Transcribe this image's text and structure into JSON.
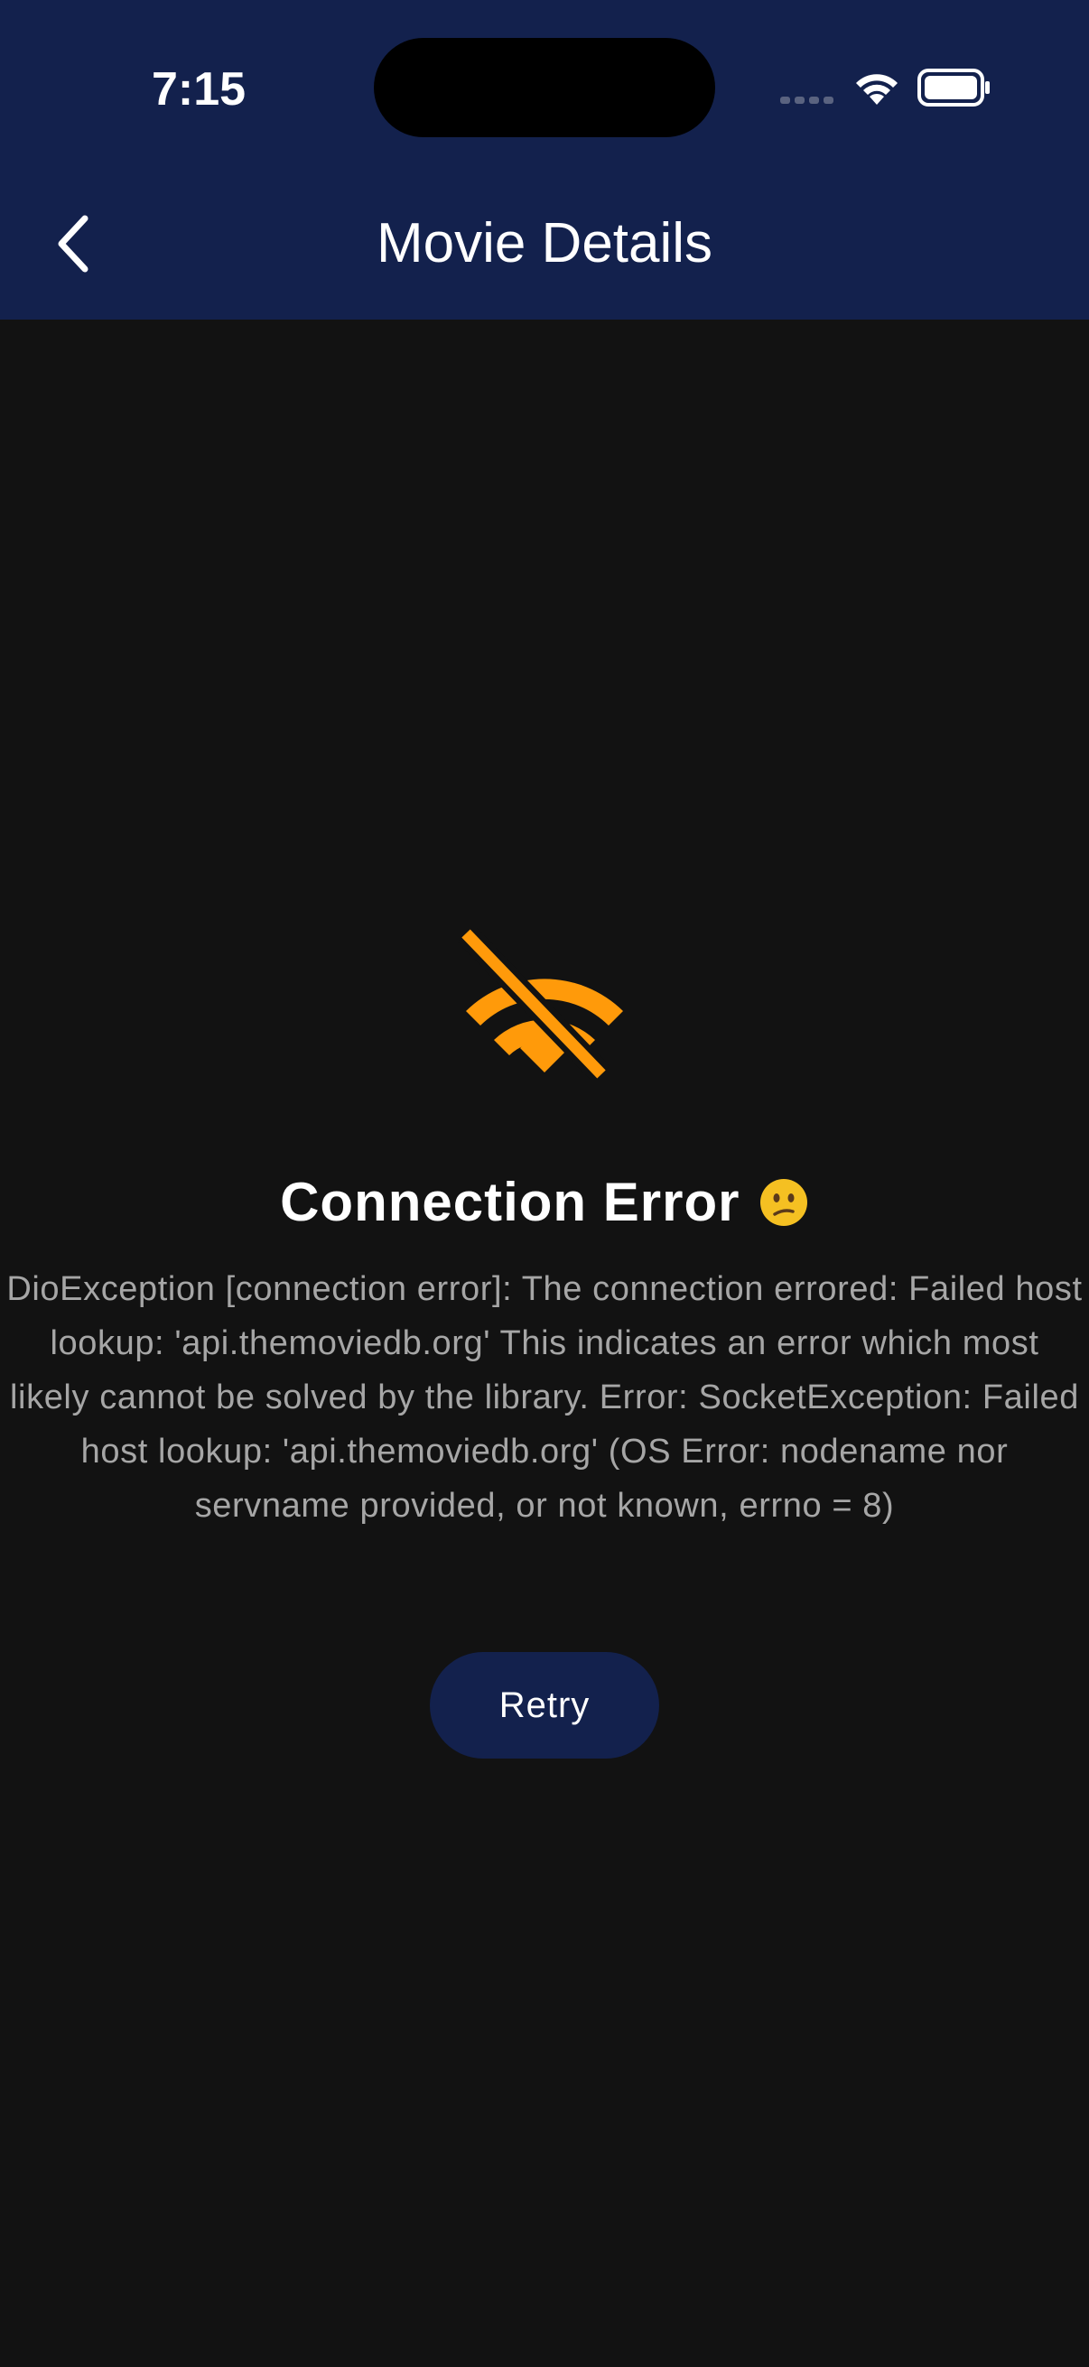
{
  "status_bar": {
    "time": "7:15",
    "signal_icon": "cellular-signal-icon",
    "wifi_icon": "wifi-icon",
    "battery_icon": "battery-icon"
  },
  "header": {
    "back_icon": "chevron-left-icon",
    "title": "Movie Details",
    "background_color": "#13214d"
  },
  "error": {
    "icon": "wifi-off-icon",
    "icon_color": "#ff9a0a",
    "title": "Connection Error",
    "emoji": "confused-face-emoji",
    "message": "DioException [connection error]: The connection errored: Failed host lookup: 'api.themoviedb.org' This indicates an error which most likely cannot be solved by the library. Error: SocketException: Failed host lookup: 'api.themoviedb.org' (OS Error: nodename nor servname provided, or not known, errno = 8)"
  },
  "actions": {
    "retry_label": "Retry",
    "retry_color": "#13214d"
  }
}
